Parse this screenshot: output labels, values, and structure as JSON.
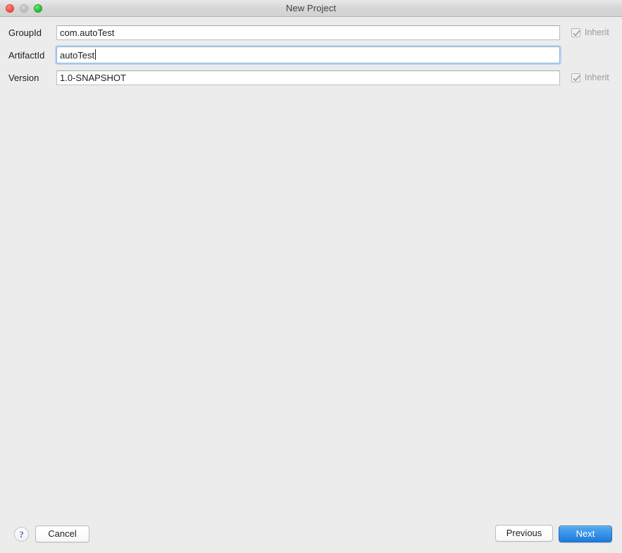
{
  "window": {
    "title": "New Project",
    "controls": {
      "close": "close-button",
      "minimize": "minimize-button",
      "maximize": "maximize-button"
    }
  },
  "form": {
    "fields": [
      {
        "id": "group-id",
        "label": "GroupId",
        "value": "com.autoTest",
        "placeholder": "",
        "focused": false,
        "inherit": {
          "label": "Inherit",
          "checked": true,
          "enabled": false,
          "visible": true
        }
      },
      {
        "id": "artifact-id",
        "label": "ArtifactId",
        "value": "autoTest",
        "placeholder": "",
        "focused": true,
        "inherit": {
          "label": "Inherit",
          "checked": false,
          "enabled": false,
          "visible": false
        }
      },
      {
        "id": "version",
        "label": "Version",
        "value": "1.0-SNAPSHOT",
        "placeholder": "",
        "focused": false,
        "inherit": {
          "label": "Inherit",
          "checked": true,
          "enabled": false,
          "visible": true
        }
      }
    ]
  },
  "footer": {
    "help_label": "?",
    "cancel_label": "Cancel",
    "previous_label": "Previous",
    "next_label": "Next"
  },
  "colors": {
    "window_background": "#ececec",
    "titlebar_top": "#e9e9e9",
    "titlebar_bottom": "#d2d2d2",
    "primary_button": "#3b95e8",
    "close_button": "#fd5e52",
    "minimize_button": "#c4c4c4",
    "maximize_button": "#31c73f",
    "field_border": "#bdbdbd",
    "focus_ring": "#b9d4ef",
    "label_text": "#1d1d1d",
    "disabled_text": "#9a9a9a",
    "help_icon": "#2f72c4"
  }
}
